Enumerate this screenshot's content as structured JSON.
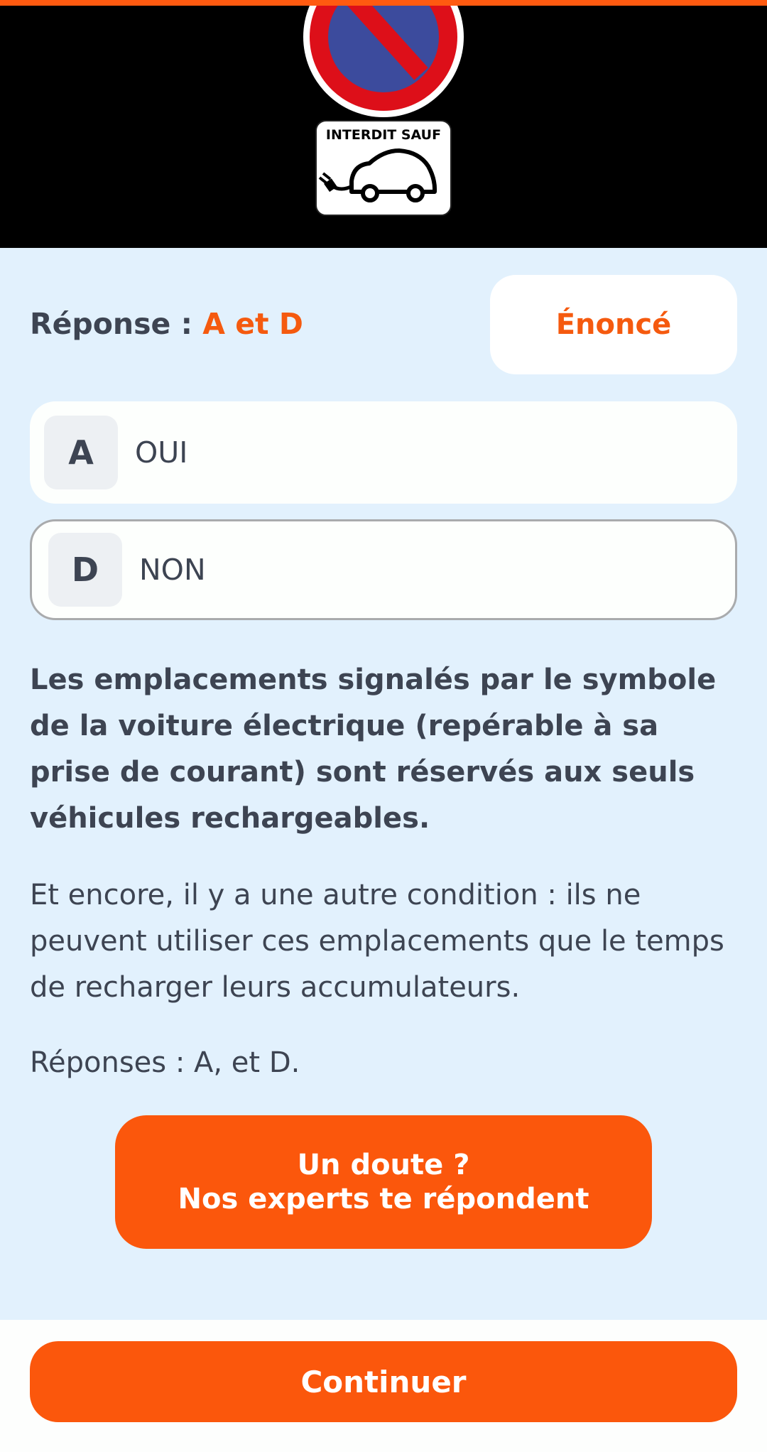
{
  "colors": {
    "accent": "#fb570c",
    "answer_highlight": "#f55a0f",
    "background": "#e2f1fd",
    "text": "#3d4452",
    "top_bar": "#ff5a10"
  },
  "sign": {
    "panel_text": "INTERDIT SAUF",
    "icons": [
      "no-parking-sign-icon",
      "electric-car-icon"
    ]
  },
  "answer": {
    "prefix": "Réponse : ",
    "value": "A et D"
  },
  "enonce_button": "Énoncé",
  "choices": [
    {
      "letter": "A",
      "text": "OUI"
    },
    {
      "letter": "D",
      "text": "NON"
    }
  ],
  "explanation": "Les emplacements signalés par le symbole de la voiture électrique (repérable à sa prise de courant) sont réservés aux seuls véhicules rechargeables.",
  "detail": "Et encore, il y a une autre condition : ils ne peuvent utiliser ces emplacements que le temps de recharger leurs accumulateurs.",
  "answers_summary": "Réponses : A, et D.",
  "expert_button": {
    "line1": "Un doute ?",
    "line2": "Nos experts te répondent"
  },
  "continue_button": "Continuer"
}
